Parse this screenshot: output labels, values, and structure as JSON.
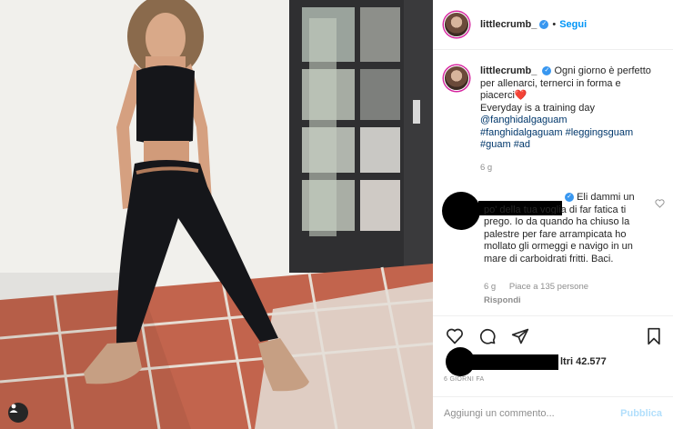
{
  "post": {
    "image_alt": "Woman in black sports bra and leggings posing in front of a white wall and glass door",
    "colors": {
      "wall": "#ecebe7",
      "tiles": "#b4543f",
      "outfit": "#15161a",
      "door": "#2f2f31"
    }
  },
  "header": {
    "username": "littlecrumb_",
    "verified_icon": "verified-badge-icon",
    "separator": "•",
    "follow_label": "Segui"
  },
  "caption": {
    "username": "littlecrumb_",
    "text_1": "Ogni giorno è perfetto per allenarci, ternerci in forma e piacerci",
    "emoji": "❤️",
    "text_2": "Everyday is a training day",
    "mention": "@fanghidalgaguam",
    "hashtags": "#fanghidalgaguam #leggingsguam #guam #ad",
    "time": "6 g"
  },
  "comment": {
    "text": "Eli dammi un po' della tua voglia di far fatica ti prego. Io da quando ha chiuso la palestre per fare arrampicata ho mollato gli ormeggi e navigo in un mare di carboidrati fritti. Baci.",
    "time": "6 g",
    "likes": "Piace a 135 persone",
    "reply_label": "Rispondi"
  },
  "actions": {
    "likes_suffix": "ltri 42.577",
    "date": "6 GIORNI FA"
  },
  "composer": {
    "placeholder": "Aggiungi un commento...",
    "publish_label": "Pubblica"
  }
}
